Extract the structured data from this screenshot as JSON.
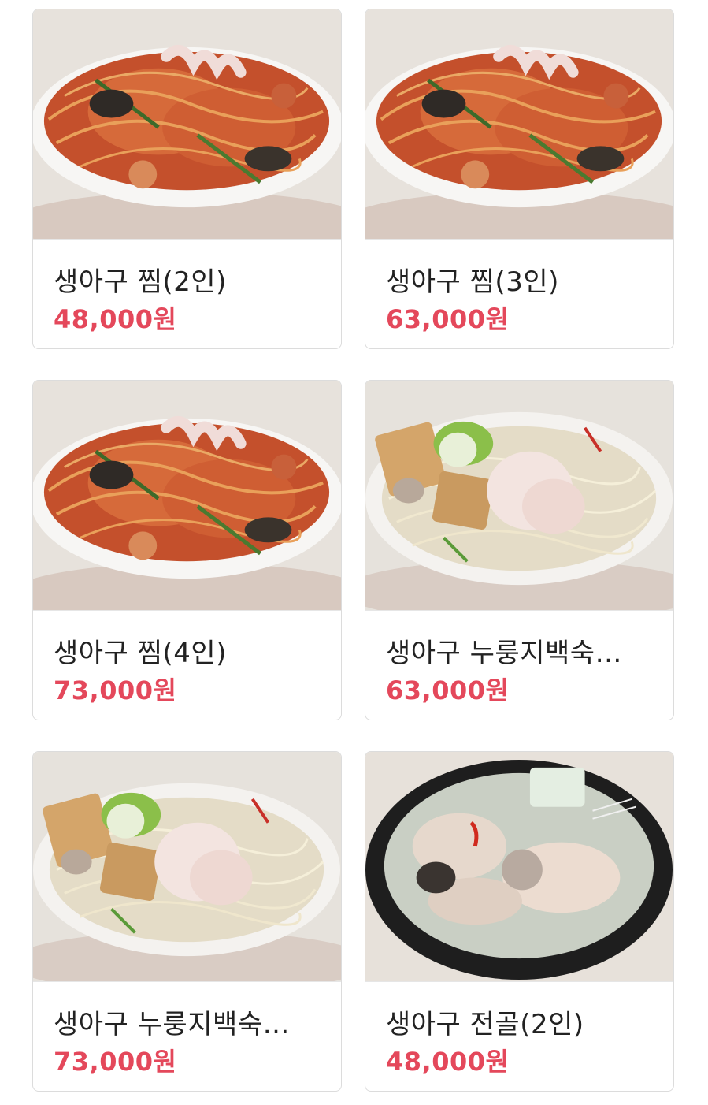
{
  "menu": {
    "items": [
      {
        "name": "생아구 찜(2인)",
        "price": "48,000원",
        "image": "spicy-braised-monkfish-photo"
      },
      {
        "name": "생아구 찜(3인)",
        "price": "63,000원",
        "image": "spicy-braised-monkfish-photo"
      },
      {
        "name": "생아구 찜(4인)",
        "price": "73,000원",
        "image": "spicy-braised-monkfish-photo"
      },
      {
        "name": "생아구 누룽지백숙…",
        "price": "63,000원",
        "image": "white-monkfish-nurungji-photo"
      },
      {
        "name": "생아구 누룽지백숙…",
        "price": "73,000원",
        "image": "white-monkfish-nurungji-photo"
      },
      {
        "name": "생아구 전골(2인)",
        "price": "48,000원",
        "image": "monkfish-hotpot-photo"
      }
    ]
  },
  "colors": {
    "price": "#e4485b",
    "name": "#222222",
    "card_border": "#dcdcdc"
  }
}
